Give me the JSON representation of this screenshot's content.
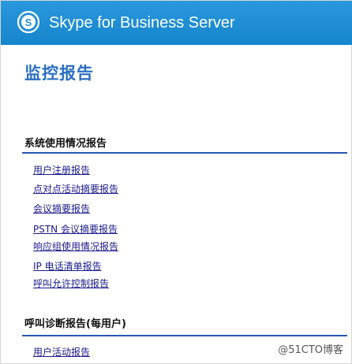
{
  "header": {
    "app_title": "Skype for Business Server",
    "logo_icon": "skype-logo-icon",
    "background_color": "#1d8fd6"
  },
  "page": {
    "title": "监控报告"
  },
  "sections": [
    {
      "heading": "系统使用情况报告",
      "links": [
        "用户注册报告",
        "点对点活动摘要报告",
        "会议摘要报告",
        "PSTN 会议摘要报告",
        "响应组使用情况报告",
        "IP 电话清单报告",
        "呼叫允许控制报告"
      ]
    },
    {
      "heading": "呼叫诊断报告(每用户)",
      "links": [
        "用户活动报告"
      ]
    }
  ],
  "watermark": {
    "text": "@51CTO博客"
  },
  "colors": {
    "page_title": "#2b6fc2",
    "link": "#1a1a8c",
    "section_rule": "#2a55b5"
  }
}
